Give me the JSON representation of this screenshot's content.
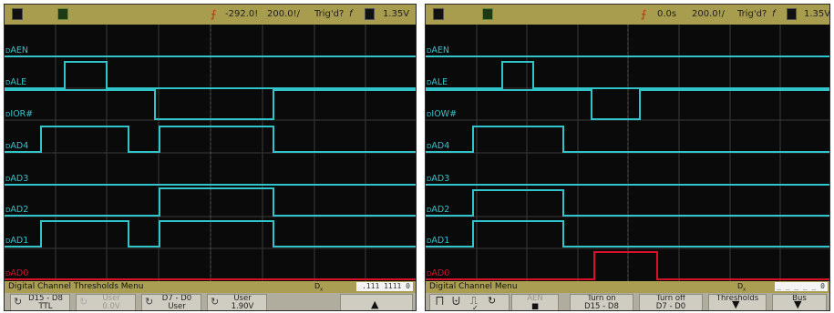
{
  "colors": {
    "background": "#0a0a0a",
    "status_bar": "#a89d4e",
    "trace": "#31c4ca",
    "ad0_trace": "#d8102a",
    "grid": "#3a3a3a",
    "trigger": "#b24b18"
  },
  "left": {
    "status": {
      "box1": "1",
      "box2": "2",
      "time": "-292.0!",
      "timebase": "200.0!/",
      "trig": "Trig'd?",
      "slope": "f",
      "chan": "1",
      "level": "1.35V"
    },
    "channels": [
      "AEN",
      "ALE",
      "IOR#",
      "AD4",
      "AD3",
      "AD2",
      "AD1",
      "AD0"
    ],
    "menu_title": "Digital Channel Thresholds Menu",
    "pattern": ".111 1111 0",
    "softkeys": [
      {
        "icon": "cycle-icon",
        "line1": "D15 - D8",
        "line2": "TTL",
        "dim": false
      },
      {
        "icon": "cycle-icon",
        "line1": "User",
        "line2": "0.0V",
        "dim": true
      },
      {
        "icon": "cycle-icon",
        "line1": "D7 - D0",
        "line2": "User",
        "dim": false
      },
      {
        "icon": "cycle-icon",
        "line1": "User",
        "line2": "1.90V",
        "dim": false
      },
      {
        "icon": "up-arrow-icon",
        "line1": "",
        "line2": "",
        "dim": false
      }
    ]
  },
  "right": {
    "status": {
      "box1": "1",
      "box2": "2",
      "time": "0.0s",
      "timebase": "200.0!/",
      "trig": "Trig'd?",
      "slope": "f",
      "chan": "1",
      "level": "1.35V"
    },
    "channels": [
      "AEN",
      "ALE",
      "IOW#",
      "AD4",
      "AD3",
      "AD2",
      "AD1",
      "AD0"
    ],
    "menu_title": "Digital Channel Menu",
    "pattern": "_ _ _ _ _ 0",
    "softkeys": [
      {
        "icon": "edge-icons",
        "line1": "",
        "line2": "",
        "dim": false
      },
      {
        "icon": "cycle-icon",
        "line1": "AEN",
        "line2": "■",
        "dim": true
      },
      {
        "icon": "",
        "line1": "Turn on",
        "line2": "D15 - D8",
        "dim": false
      },
      {
        "icon": "",
        "line1": "Turn off",
        "line2": "D7 - D0",
        "dim": false
      },
      {
        "icon": "down-arrow-icon",
        "line1": "Thresholds",
        "line2": "",
        "dim": false
      },
      {
        "icon": "down-arrow-icon",
        "line1": "Bus",
        "line2": "",
        "dim": false
      }
    ]
  }
}
